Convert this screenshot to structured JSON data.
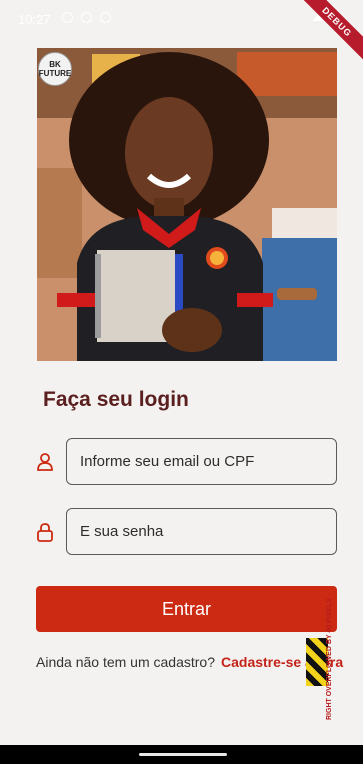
{
  "status_bar": {
    "time": "10:27",
    "icons": [
      "notification-icon",
      "sim-icon",
      "sync-icon",
      "wifi-icon",
      "signal-icon",
      "battery-icon"
    ]
  },
  "debug_banner": "DEBUG",
  "hero": {
    "logo_text_line1": "BK",
    "logo_text_line2": "FUTURE"
  },
  "login": {
    "title": "Faça seu login",
    "email_placeholder": "Informe seu email ou CPF",
    "password_placeholder": "E sua senha",
    "submit_label": "Entrar"
  },
  "signup": {
    "prompt": "Ainda não tem um cadastro?",
    "link": "Cadastre-se agora"
  },
  "overflow": {
    "message": "RIGHT OVERFLOWED BY 40 PIXELS"
  },
  "colors": {
    "accent": "#cc2a12",
    "title": "#5a1f1f",
    "link": "#c4231a",
    "background": "#f4f2f0"
  }
}
